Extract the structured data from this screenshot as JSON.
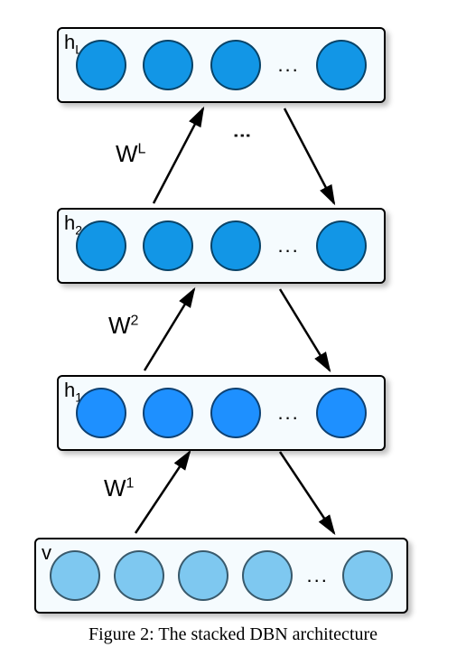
{
  "diagram": {
    "layers": [
      {
        "id": "hL",
        "label_main": "h",
        "label_sub": "L",
        "nodes": 4,
        "node_style": "dark",
        "ellipsis_after_index": 2
      },
      {
        "id": "h2",
        "label_main": "h",
        "label_sub": "2",
        "nodes": 4,
        "node_style": "dark",
        "ellipsis_after_index": 2
      },
      {
        "id": "h1",
        "label_main": "h",
        "label_sub": "1",
        "nodes": 4,
        "node_style": "mid",
        "ellipsis_after_index": 2
      },
      {
        "id": "v",
        "label_main": "v",
        "label_sub": "",
        "nodes": 5,
        "node_style": "light",
        "ellipsis_after_index": 3
      }
    ],
    "weights": [
      {
        "label_main": "W",
        "label_sup": "L"
      },
      {
        "label_main": "W",
        "label_sup": "2"
      },
      {
        "label_main": "W",
        "label_sup": "1"
      }
    ],
    "gap_ellipsis": "⋮",
    "node_ellipsis": "..."
  },
  "caption": "Figure 2: The stacked DBN architecture"
}
